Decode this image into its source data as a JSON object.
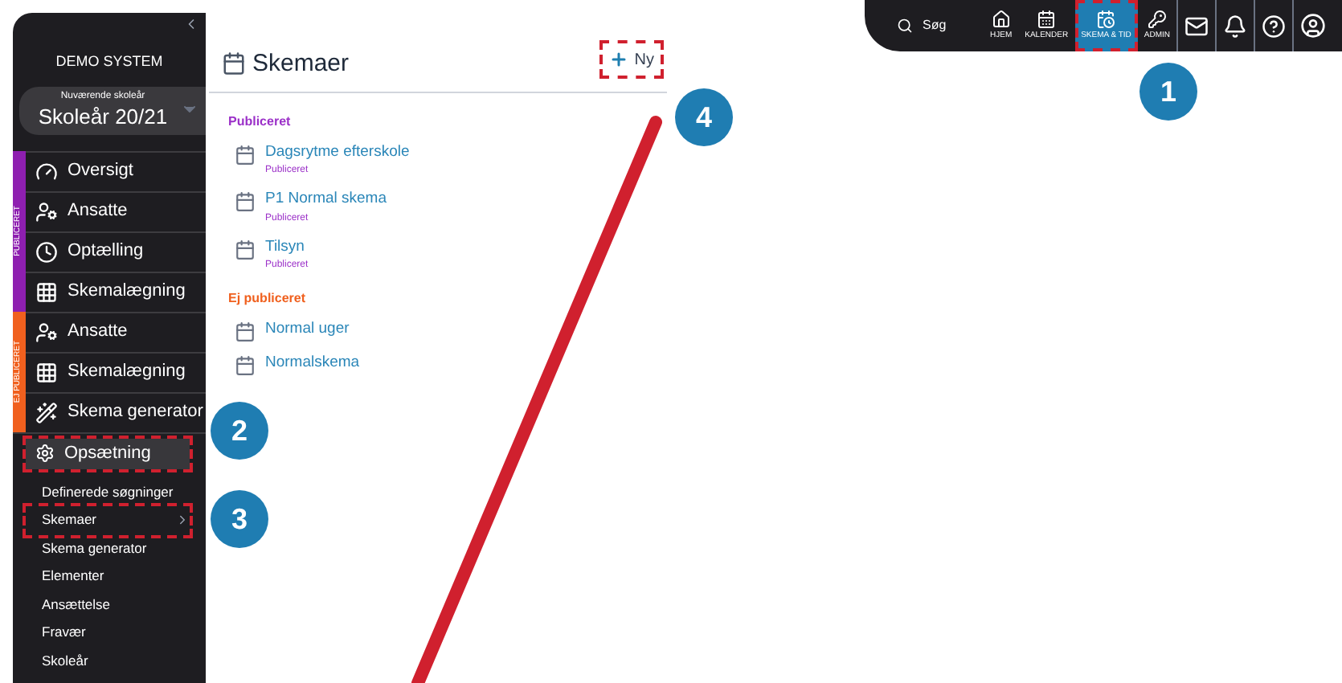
{
  "topbar": {
    "search_label": "Søg",
    "nav": [
      {
        "label": "HJEM",
        "kind": "home",
        "selected": false,
        "highlighted": false
      },
      {
        "label": "KALENDER",
        "kind": "calendar",
        "selected": false,
        "highlighted": false
      },
      {
        "label": "SKEMA & TID",
        "kind": "schedule",
        "selected": true,
        "highlighted": true
      },
      {
        "label": "ADMIN",
        "kind": "key",
        "selected": false,
        "highlighted": false
      }
    ],
    "tools": [
      {
        "kind": "mail"
      },
      {
        "kind": "bell"
      },
      {
        "kind": "help"
      },
      {
        "kind": "user"
      }
    ]
  },
  "sidebar": {
    "system_name": "DEMO SYSTEM",
    "year_caption": "Nuværende skoleår",
    "year_value": "Skoleår 20/21",
    "groups": [
      {
        "label": "PUBLICERET",
        "color": "#8e1fb0",
        "items": [
          {
            "label": "Oversigt",
            "kind": "gauge"
          },
          {
            "label": "Ansatte",
            "kind": "users"
          },
          {
            "label": "Optælling",
            "kind": "clock"
          },
          {
            "label": "Skemalægning",
            "kind": "grid"
          }
        ]
      },
      {
        "label": "EJ PUBLICERET",
        "color": "#f0601e",
        "items": [
          {
            "label": "Ansatte",
            "kind": "users"
          },
          {
            "label": "Skemalægning",
            "kind": "grid"
          },
          {
            "label": "Skema generator",
            "kind": "wand"
          }
        ]
      }
    ],
    "setup": {
      "label": "Opsætning",
      "expanded": true,
      "highlighted": true,
      "children": [
        {
          "label": "Definerede søgninger",
          "selected": false,
          "highlighted": false
        },
        {
          "label": "Skemaer",
          "selected": true,
          "highlighted": true
        },
        {
          "label": "Skema generator",
          "selected": false,
          "highlighted": false
        },
        {
          "label": "Elementer",
          "selected": false,
          "highlighted": false
        },
        {
          "label": "Ansættelse",
          "selected": false,
          "highlighted": false
        },
        {
          "label": "Fravær",
          "selected": false,
          "highlighted": false
        },
        {
          "label": "Skoleår",
          "selected": false,
          "highlighted": false
        }
      ]
    }
  },
  "main": {
    "title": "Skemaer",
    "new_button": {
      "label": "Ny",
      "highlighted": true
    },
    "sections": [
      {
        "title": "Publiceret",
        "color": "#9b30c8",
        "items": [
          {
            "name": "Dagsrytme efterskole",
            "status": "Publiceret"
          },
          {
            "name": "P1 Normal skema",
            "status": "Publiceret"
          },
          {
            "name": "Tilsyn",
            "status": "Publiceret"
          }
        ]
      },
      {
        "title": "Ej publiceret",
        "color": "#f0601e",
        "items": [
          {
            "name": "Normal uger"
          },
          {
            "name": "Normalskema"
          }
        ]
      }
    ]
  },
  "callouts": [
    {
      "number": "1"
    },
    {
      "number": "2"
    },
    {
      "number": "3"
    },
    {
      "number": "4"
    }
  ]
}
